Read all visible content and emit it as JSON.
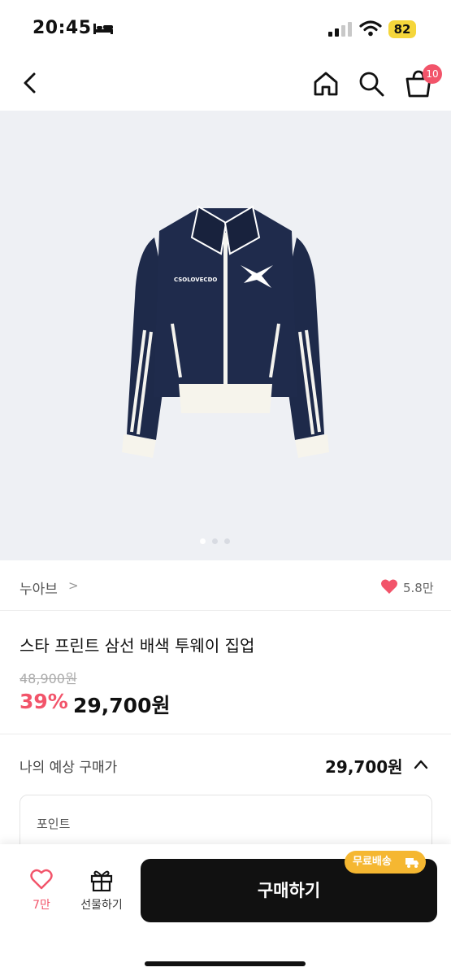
{
  "status_bar": {
    "time": "20:45",
    "battery": "82"
  },
  "header": {
    "cart_count": "10"
  },
  "brand": {
    "name": "누아브",
    "chevron": ">",
    "like_count": "5.8만"
  },
  "product": {
    "title": "스타 프린트 삼선 배색 투웨이 집업",
    "original_price": "48,900원",
    "discount": "39%",
    "sale_price": "29,700원"
  },
  "expected": {
    "label": "나의 예상 구매가",
    "price": "29,700원"
  },
  "point": {
    "label": "포인트"
  },
  "bottom_bar": {
    "wish_count": "7만",
    "gift_label": "선물하기",
    "buy_label": "구매하기",
    "shipping_badge": "무료배송"
  },
  "jacket_print": "CSOLOVECDO",
  "colors": {
    "accent": "#f2546a",
    "badge": "#f5b731",
    "buy": "#111111",
    "jacket": "#1e2a4a"
  },
  "icons": [
    "bed-icon",
    "signal-icon",
    "wifi-icon",
    "back-icon",
    "home-icon",
    "search-icon",
    "cart-icon",
    "heart-icon",
    "gift-icon",
    "truck-icon",
    "chevron-up-icon"
  ]
}
